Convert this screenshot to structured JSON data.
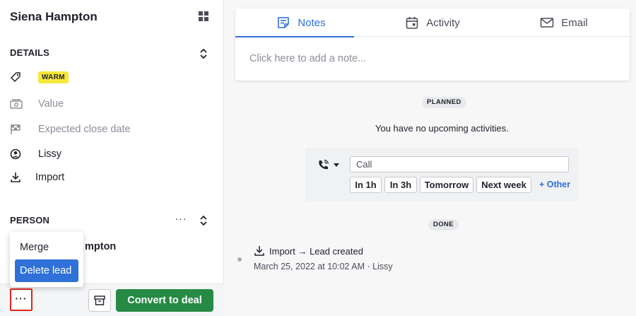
{
  "lead": {
    "name": "Siena Hampton"
  },
  "details": {
    "title": "DETAILS",
    "label_badge": "WARM",
    "value_placeholder": "Value",
    "close_date_placeholder": "Expected close date",
    "owner": "Lissy",
    "source": "Import"
  },
  "person": {
    "title": "PERSON",
    "more_label": "···",
    "name_visible": "mpton"
  },
  "context_menu": {
    "merge_label": "Merge",
    "delete_label": "Delete lead"
  },
  "footer": {
    "more_label": "···",
    "convert_label": "Convert to deal"
  },
  "tabs": [
    {
      "label": "Notes",
      "icon": "note-icon",
      "active": true
    },
    {
      "label": "Activity",
      "icon": "calendar-icon",
      "active": false
    },
    {
      "label": "Email",
      "icon": "envelope-icon",
      "active": false
    }
  ],
  "notes": {
    "placeholder": "Click here to add a note..."
  },
  "planned": {
    "label": "PLANNED",
    "empty_text": "You have no upcoming activities."
  },
  "scheduler": {
    "subject_value": "Call",
    "quick_buttons": [
      "In 1h",
      "In 3h",
      "Tomorrow",
      "Next week"
    ],
    "other_label": "+ Other"
  },
  "done": {
    "label": "DONE",
    "event_text": "Import → Lead created",
    "event_meta": "March 25, 2022 at 10:02 AM · Lissy"
  },
  "colors": {
    "accent": "#2f71d8",
    "convert": "#268a45",
    "badge": "#f6e83a",
    "highlight_border": "#e0261e"
  }
}
